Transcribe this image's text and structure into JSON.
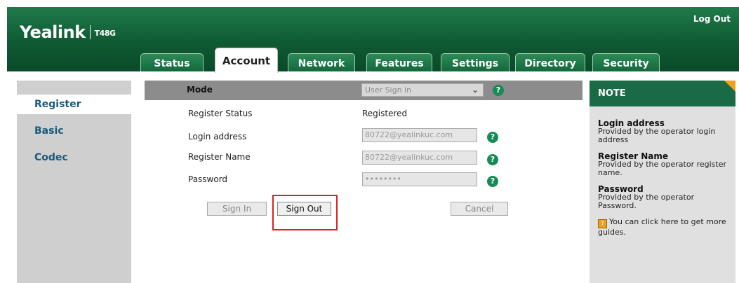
{
  "header": {
    "brand": "Yealink",
    "model": "T48G",
    "logout_label": "Log Out"
  },
  "tabs": [
    {
      "label": "Status",
      "active": false
    },
    {
      "label": "Account",
      "active": true
    },
    {
      "label": "Network",
      "active": false
    },
    {
      "label": "Features",
      "active": false
    },
    {
      "label": "Settings",
      "active": false
    },
    {
      "label": "Directory",
      "active": false
    },
    {
      "label": "Security",
      "active": false
    }
  ],
  "sidebar": {
    "items": [
      {
        "label": "Register",
        "active": true
      },
      {
        "label": "Basic",
        "active": false
      },
      {
        "label": "Codec",
        "active": false
      }
    ]
  },
  "form": {
    "mode_label": "Mode",
    "mode_value": "User Sign in",
    "status_label": "Register Status",
    "status_value": "Registered",
    "login_label": "Login address",
    "login_value": "80722@yealinkuc.com",
    "regname_label": "Register Name",
    "regname_value": "80722@yealinkuc.com",
    "password_label": "Password",
    "password_value": "••••••••",
    "help_glyph": "?"
  },
  "buttons": {
    "sign_in": "Sign In",
    "sign_out": "Sign Out",
    "cancel": "Cancel"
  },
  "note": {
    "title": "NOTE",
    "items": [
      {
        "title": "Login address",
        "text": "Provided by the operator login address"
      },
      {
        "title": "Register Name",
        "text": "Provided by the operator register name."
      },
      {
        "title": "Password",
        "text": "Provided by the operator Password."
      }
    ],
    "guide_text": "You can click here to get more guides."
  },
  "colors": {
    "header_green": "#0f5a33",
    "note_green": "#1a6b45",
    "highlight_red": "#e02020",
    "corner_orange": "#f0a020"
  }
}
